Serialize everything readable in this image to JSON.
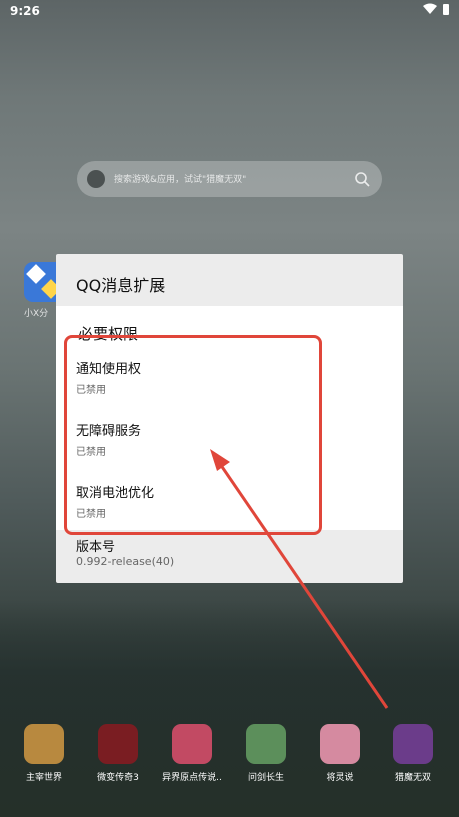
{
  "status_bar": {
    "time": "9:26"
  },
  "search": {
    "placeholder": "搜索游戏&应用，试试\"猎魔无双\""
  },
  "left_app": {
    "label": "小X分"
  },
  "settings": {
    "title": "QQ消息扩展",
    "version_label": "版本号",
    "version_value": "0.992-release(40)"
  },
  "permission_dialog": {
    "title": "必要权限",
    "items": [
      {
        "name": "通知使用权",
        "status": "已禁用"
      },
      {
        "name": "无障碍服务",
        "status": "已禁用"
      },
      {
        "name": "取消电池优化",
        "status": "已禁用"
      }
    ]
  },
  "dock": {
    "apps": [
      {
        "label": "主宰世界",
        "color": "#b8893f"
      },
      {
        "label": "微变传奇3",
        "color": "#7a1d22"
      },
      {
        "label": "异界原点传说..",
        "color": "#c24a63"
      },
      {
        "label": "问剑长生",
        "color": "#5c8f5b"
      },
      {
        "label": "将灵说",
        "color": "#d58aa0"
      },
      {
        "label": "猎魔无双",
        "color": "#6b3c8a"
      }
    ]
  },
  "annotation": {
    "color": "#e0463a"
  }
}
